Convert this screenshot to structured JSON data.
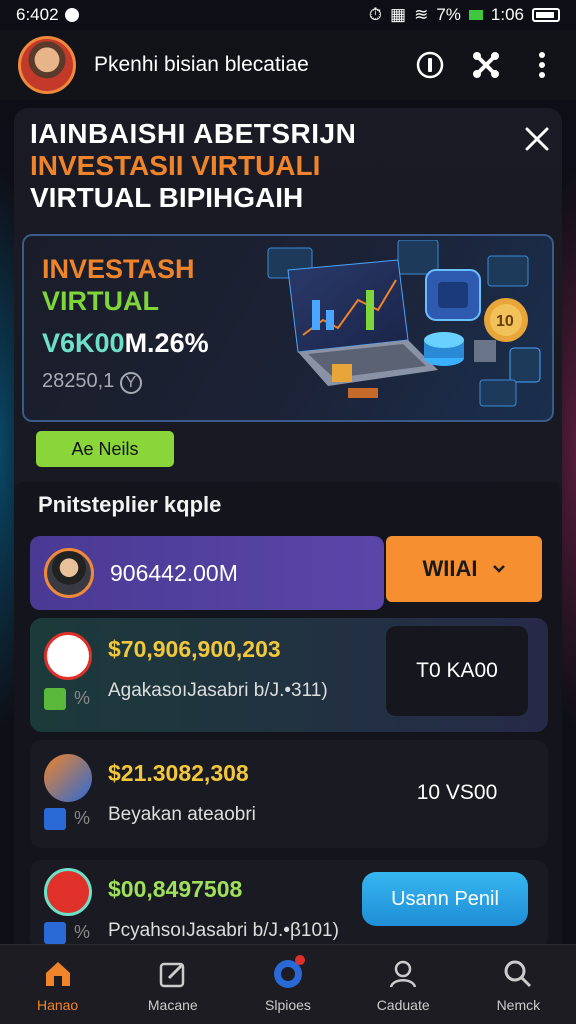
{
  "status_bar": {
    "time": "6:402",
    "battery_pct": "7%",
    "clock": "1:06"
  },
  "header": {
    "app_title": "Pkenhi bisian blecatiae"
  },
  "hero": {
    "line1": "IAINBAISHI ABETSRIJN",
    "line2": "INVESTASII VIRTUALI",
    "line3": "VIRTUAL BIPIHGAIH"
  },
  "banner": {
    "line1": "INVESTASH",
    "line2": "VIRTUAL",
    "line3_teal": "V6K00",
    "line3_white": "M.26%",
    "line4": "28250,1",
    "line4_icon": "Y"
  },
  "green_button": {
    "label": "Ae Neils"
  },
  "list": {
    "heading": "Pnitsteplier kqple",
    "row1": {
      "value": "906442.00M",
      "button_label": "WIIAI",
      "button_icon": "chevron-down-icon"
    },
    "cards": [
      {
        "amount": "$70,906,900,203",
        "sub": "AgakasoıJasabri b/J.•311)",
        "action": "T0 KA00",
        "amount_color": "#f2c83a"
      },
      {
        "amount": "$21.3082,308",
        "sub": "Beyakan ateaobri",
        "action": "10 VS00",
        "amount_color": "#f2c83a"
      },
      {
        "amount": "$00,8497508",
        "sub": "PcyahsoıJasabri b/J.•β101)",
        "action": "Usann Penil",
        "amount_color": "#9ee05a"
      }
    ]
  },
  "bottom_nav": [
    {
      "label": "Hanao",
      "icon": "home-icon",
      "active": true
    },
    {
      "label": "Macane",
      "icon": "edit-square-icon",
      "active": false
    },
    {
      "label": "Slpioes",
      "icon": "compass-icon",
      "active": false
    },
    {
      "label": "Caduate",
      "icon": "user-icon",
      "active": false
    },
    {
      "label": "Nemck",
      "icon": "search-icon",
      "active": false
    }
  ],
  "colors": {
    "accent_orange": "#f0842a",
    "accent_green": "#8ad63a",
    "accent_blue": "#36b6f0",
    "row_purple": "#4a3a94"
  }
}
